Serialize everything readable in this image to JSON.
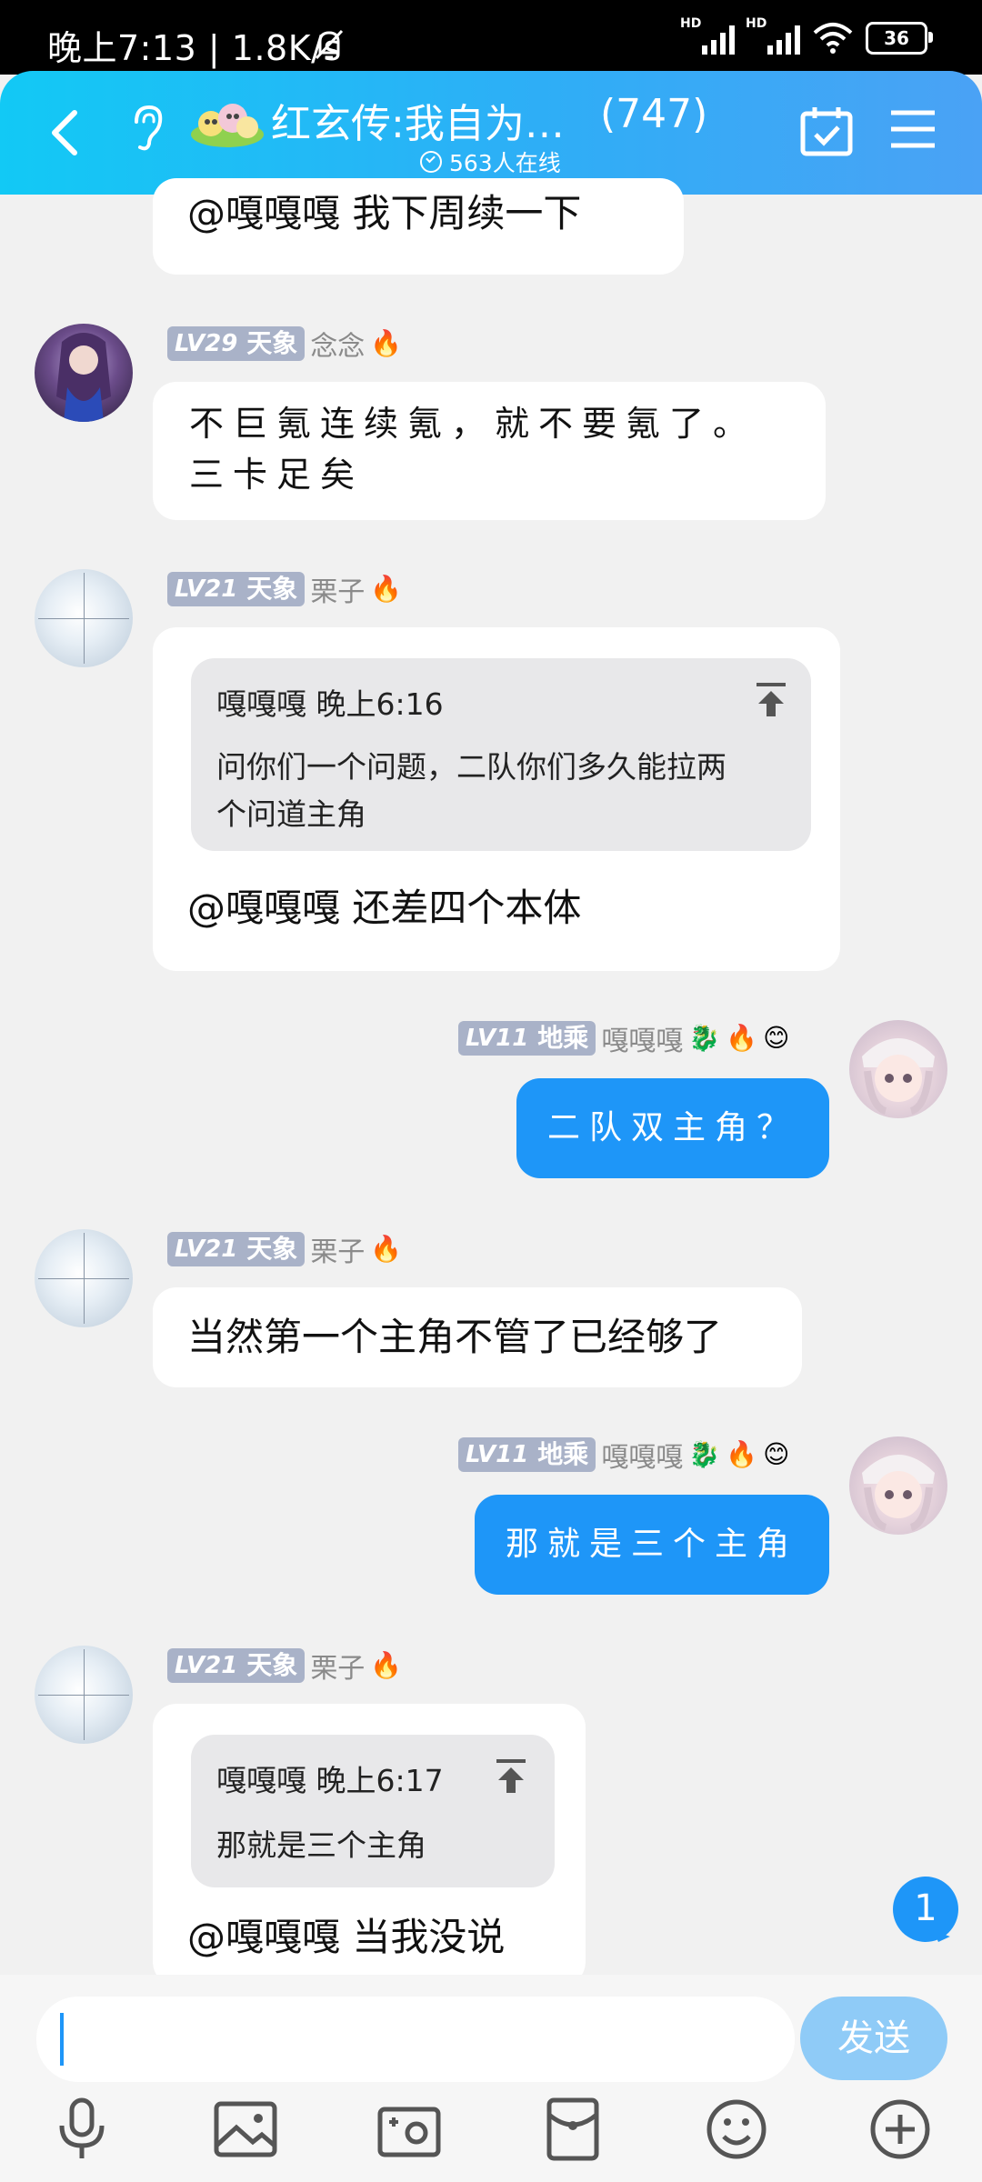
{
  "status_bar": {
    "time_speed": "晚上7:13 | 1.8K/s",
    "signal1": "HD",
    "signal2": "HD",
    "battery": "36"
  },
  "header": {
    "title": "红玄传:我自为…",
    "member_count": "(747)",
    "online": "563人在线"
  },
  "messages": [
    {
      "text": "@嘎嘎嘎 我下周续一下"
    },
    {
      "level": "LV29",
      "rank": "天象",
      "user": "念念",
      "text": "不巨氪连续氪，就不要氪了。三卡足矣"
    },
    {
      "level": "LV21",
      "rank": "天象",
      "user": "栗子",
      "quote": {
        "author": "嘎嘎嘎",
        "time": "晚上6:16",
        "text_line1": "问你们一个问题，二队你们多久能拉两",
        "text_line2": "个问道主角"
      },
      "text": "@嘎嘎嘎 还差四个本体"
    },
    {
      "level": "LV11",
      "rank": "地乘",
      "user": "嘎嘎嘎",
      "text": "二队双主角？"
    },
    {
      "level": "LV21",
      "rank": "天象",
      "user": "栗子",
      "text": "当然第一个主角不管了已经够了"
    },
    {
      "level": "LV11",
      "rank": "地乘",
      "user": "嘎嘎嘎",
      "text": "那就是三个主角"
    },
    {
      "level": "LV21",
      "rank": "天象",
      "user": "栗子",
      "quote": {
        "author": "嘎嘎嘎",
        "time": "晚上6:17",
        "text_line1": "那就是三个主角"
      },
      "text": "@嘎嘎嘎 当我没说"
    }
  ],
  "new_message_badge": "1",
  "input": {
    "placeholder": "",
    "send_label": "发送"
  },
  "icons": [
    "back-arrow-icon",
    "ear-icon",
    "calendar-check-icon",
    "menu-icon",
    "mic-icon",
    "image-icon",
    "camera-icon",
    "red-packet-icon",
    "emoji-icon",
    "plus-icon"
  ],
  "colors": {
    "accent": "#1e96f8",
    "header_start": "#12c9f5",
    "level_badge": "#a9b2c8"
  }
}
